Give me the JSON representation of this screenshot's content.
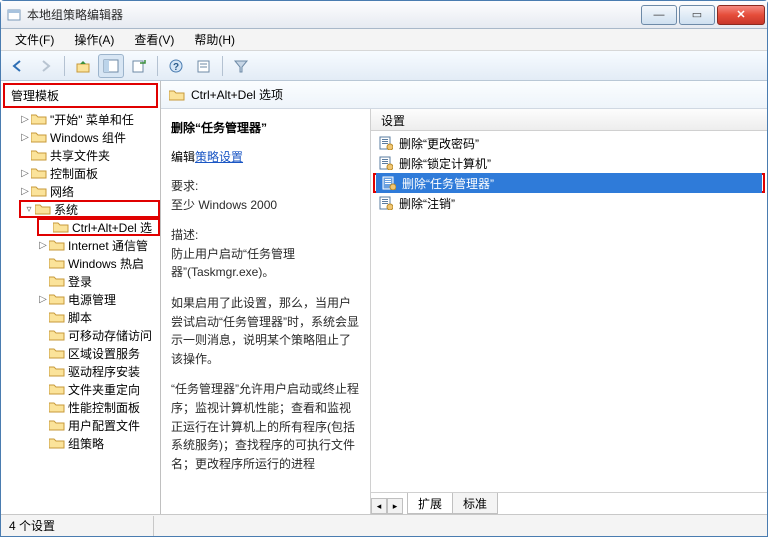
{
  "window": {
    "title": "本地组策略编辑器"
  },
  "menu": {
    "file": "文件(F)",
    "action": "操作(A)",
    "view": "查看(V)",
    "help": "帮助(H)"
  },
  "tree": {
    "root": "管理模板",
    "items": [
      {
        "label": "\"开始\" 菜单和任",
        "exp": "▷"
      },
      {
        "label": "Windows 组件",
        "exp": "▷"
      },
      {
        "label": "共享文件夹",
        "exp": ""
      },
      {
        "label": "控制面板",
        "exp": "▷"
      },
      {
        "label": "网络",
        "exp": "▷"
      }
    ],
    "system": {
      "label": "系统",
      "exp": "▿"
    },
    "cad": {
      "label": "Ctrl+Alt+Del 选"
    },
    "rest": [
      {
        "label": "Internet 通信管",
        "exp": "▷"
      },
      {
        "label": "Windows 热启",
        "exp": ""
      },
      {
        "label": "登录",
        "exp": ""
      },
      {
        "label": "电源管理",
        "exp": "▷"
      },
      {
        "label": "脚本",
        "exp": ""
      },
      {
        "label": "可移动存储访问",
        "exp": ""
      },
      {
        "label": "区域设置服务",
        "exp": ""
      },
      {
        "label": "驱动程序安装",
        "exp": ""
      },
      {
        "label": "文件夹重定向",
        "exp": ""
      },
      {
        "label": "性能控制面板",
        "exp": ""
      },
      {
        "label": "用户配置文件",
        "exp": ""
      },
      {
        "label": "组策略",
        "exp": ""
      }
    ]
  },
  "right": {
    "header": "Ctrl+Alt+Del 选项",
    "desc": {
      "title": "删除“任务管理器”",
      "edit_label": "编辑",
      "edit_link": "策略设置",
      "req_label": "要求:",
      "req_value": "至少 Windows 2000",
      "desc_label": "描述:",
      "p1": "防止用户启动“任务管理器”(Taskmgr.exe)。",
      "p2": "如果启用了此设置，那么，当用户尝试启动“任务管理器”时，系统会显示一则消息，说明某个策略阻止了该操作。",
      "p3": "“任务管理器”允许用户启动或终止程序；监视计算机性能；查看和监视正运行在计算机上的所有程序(包括系统服务)；查找程序的可执行文件名；更改程序所运行的进程"
    },
    "list": {
      "column": "设置",
      "rows": [
        {
          "label": "删除“更改密码”",
          "sel": false
        },
        {
          "label": "删除“锁定计算机”",
          "sel": false
        },
        {
          "label": "删除“任务管理器”",
          "sel": true
        },
        {
          "label": "删除“注销”",
          "sel": false
        }
      ]
    },
    "tabs": {
      "ext": "扩展",
      "std": "标准"
    }
  },
  "status": {
    "text": "4 个设置"
  }
}
